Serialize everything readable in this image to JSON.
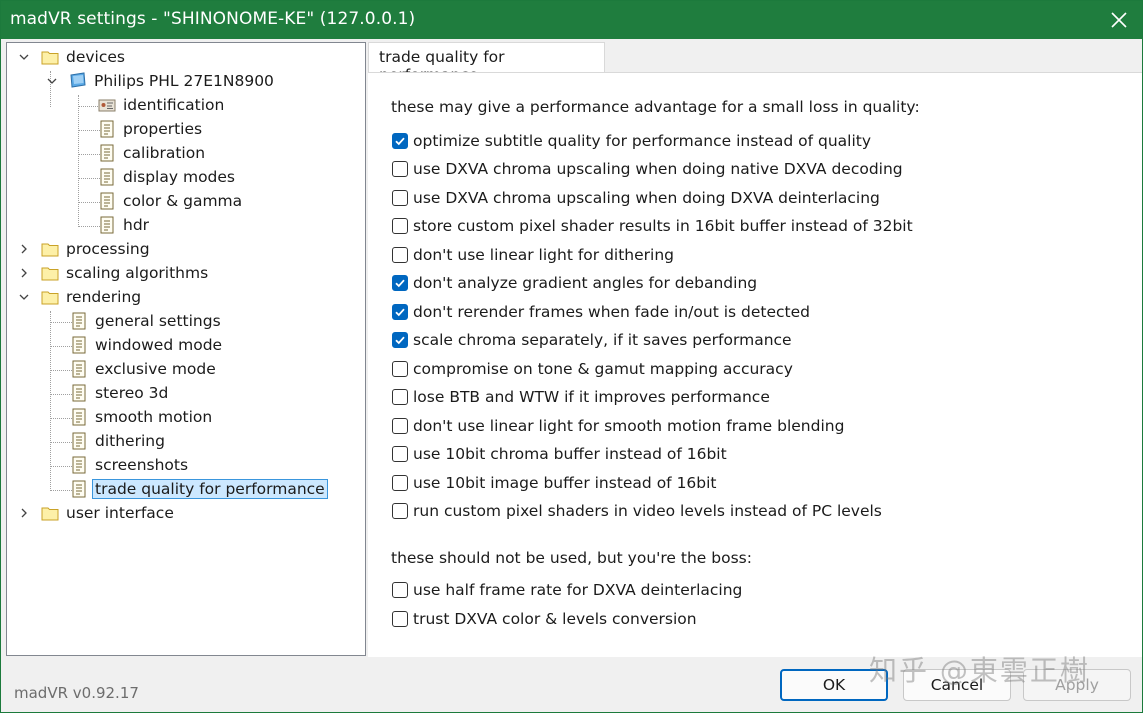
{
  "window": {
    "title": "madVR settings - \"SHINONOME-KE\" (127.0.0.1)"
  },
  "tree": {
    "devices": "devices",
    "device": "Philips PHL 27E1N8900",
    "device_items": [
      "identification",
      "properties",
      "calibration",
      "display modes",
      "color & gamma",
      "hdr"
    ],
    "processing": "processing",
    "scaling": "scaling algorithms",
    "rendering": "rendering",
    "rendering_items": [
      "general settings",
      "windowed mode",
      "exclusive mode",
      "stereo 3d",
      "smooth motion",
      "dithering",
      "screenshots",
      "trade quality for performance"
    ],
    "user_interface": "user interface"
  },
  "tab": {
    "label": "trade quality for performance"
  },
  "sections": {
    "performance": "these may give a performance advantage for a small loss in quality:",
    "boss": "these should not be used, but you're the boss:"
  },
  "options": [
    {
      "label": "optimize subtitle quality for performance instead of quality",
      "checked": true
    },
    {
      "label": "use DXVA chroma upscaling when doing native DXVA decoding",
      "checked": false
    },
    {
      "label": "use DXVA chroma upscaling when doing DXVA deinterlacing",
      "checked": false
    },
    {
      "label": "store custom pixel shader results in 16bit buffer instead of 32bit",
      "checked": false
    },
    {
      "label": "don't use linear light for dithering",
      "checked": false
    },
    {
      "label": "don't analyze gradient angles for debanding",
      "checked": true
    },
    {
      "label": "don't rerender frames when fade in/out is detected",
      "checked": true
    },
    {
      "label": "scale chroma separately, if it saves performance",
      "checked": true
    },
    {
      "label": "compromise on tone & gamut mapping accuracy",
      "checked": false
    },
    {
      "label": "lose BTB and WTW if it improves performance",
      "checked": false
    },
    {
      "label": "don't use linear light for smooth motion frame blending",
      "checked": false
    },
    {
      "label": "use 10bit chroma buffer instead of 16bit",
      "checked": false
    },
    {
      "label": "use 10bit image buffer instead of 16bit",
      "checked": false
    },
    {
      "label": "run custom pixel shaders in video levels instead of PC levels",
      "checked": false
    }
  ],
  "boss_options": [
    {
      "label": "use half frame rate for DXVA deinterlacing",
      "checked": false
    },
    {
      "label": "trust DXVA color & levels conversion",
      "checked": false
    }
  ],
  "footer": {
    "version": "madVR v0.92.17",
    "ok": "OK",
    "cancel": "Cancel",
    "apply": "Apply"
  },
  "watermark": "知乎 @東雲正樹",
  "colors": {
    "titlebar": "#1f7d3e",
    "checkbox_checked": "#0067c0",
    "selection": "#cce8ff"
  }
}
